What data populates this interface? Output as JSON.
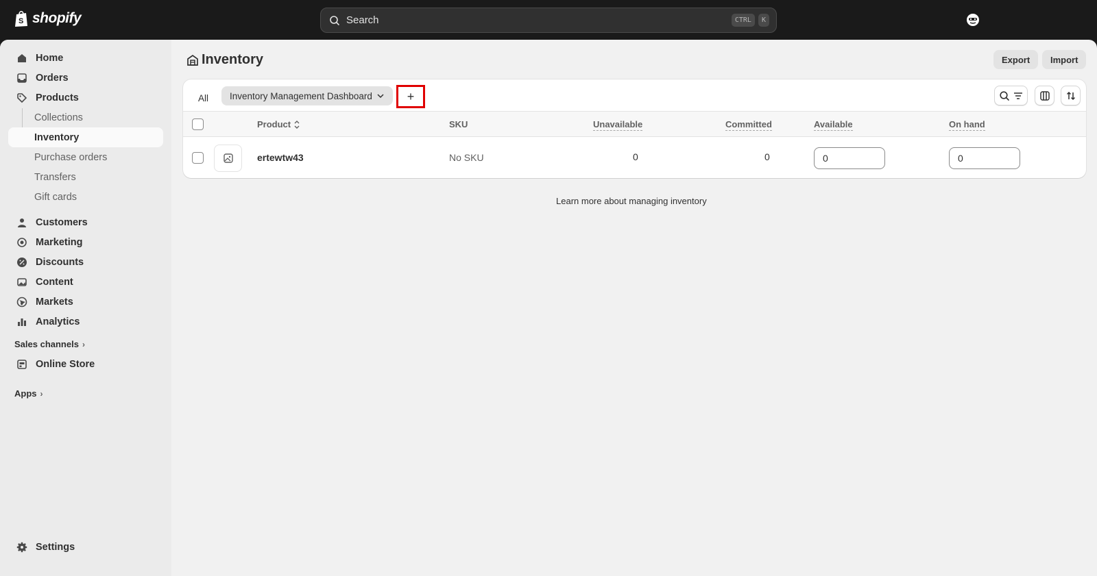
{
  "topbar": {
    "logo_text": "shopify",
    "search_placeholder": "Search",
    "shortcut_ctrl": "CTRL",
    "shortcut_key": "K"
  },
  "sidebar": {
    "home": "Home",
    "orders": "Orders",
    "products": "Products",
    "collections": "Collections",
    "inventory": "Inventory",
    "purchase_orders": "Purchase orders",
    "transfers": "Transfers",
    "gift_cards": "Gift cards",
    "customers": "Customers",
    "marketing": "Marketing",
    "discounts": "Discounts",
    "content": "Content",
    "markets": "Markets",
    "analytics": "Analytics",
    "sales_channels": "Sales channels",
    "online_store": "Online Store",
    "apps": "Apps",
    "settings": "Settings"
  },
  "page": {
    "title": "Inventory",
    "export_label": "Export",
    "import_label": "Import",
    "learn_more": "Learn more about managing inventory"
  },
  "tabs": {
    "all": "All",
    "view": "Inventory Management Dashboard",
    "add": "+"
  },
  "table": {
    "columns": {
      "product": "Product",
      "sku": "SKU",
      "unavailable": "Unavailable",
      "committed": "Committed",
      "available": "Available",
      "on_hand": "On hand"
    },
    "rows": [
      {
        "product": "ertewtw43",
        "sku": "No SKU",
        "unavailable": "0",
        "committed": "0",
        "available": "0",
        "on_hand": "0"
      }
    ]
  }
}
